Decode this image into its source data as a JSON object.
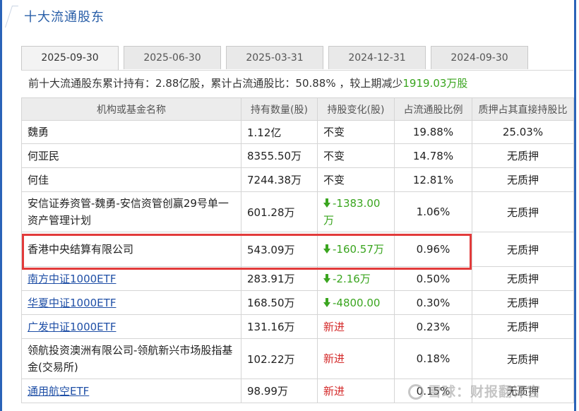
{
  "section_title": "十大流通股东",
  "tabs": [
    {
      "label": "2025-09-30",
      "active": true
    },
    {
      "label": "2025-06-30",
      "active": false
    },
    {
      "label": "2025-03-31",
      "active": false
    },
    {
      "label": "2024-12-31",
      "active": false
    },
    {
      "label": "2024-09-30",
      "active": false
    }
  ],
  "summary": {
    "prefix": "前十大流通股东累计持有：2.88亿股，累计占流通股比：50.88% ，较上期减少",
    "change": "1919.03万股"
  },
  "table": {
    "headers": [
      "机构或基金名称",
      "持有数量(股)",
      "持股变化(股)",
      "占流通股比例",
      "质押占其直接持股比"
    ],
    "rows": [
      {
        "name": "魏勇",
        "link": false,
        "amount": "1.12亿",
        "change": "不变",
        "change_type": "same",
        "pct": "19.88%",
        "pledge": "25.03%"
      },
      {
        "name": "何亚民",
        "link": false,
        "amount": "8355.50万",
        "change": "不变",
        "change_type": "same",
        "pct": "14.78%",
        "pledge": "无质押"
      },
      {
        "name": "何佳",
        "link": false,
        "amount": "7244.38万",
        "change": "不变",
        "change_type": "same",
        "pct": "12.81%",
        "pledge": "无质押"
      },
      {
        "name": "安信证券资管-魏勇-安信资管创赢29号单一资产管理计划",
        "link": false,
        "amount": "601.28万",
        "change": "-1383.00万",
        "change_type": "down",
        "pct": "1.06%",
        "pledge": "无质押"
      },
      {
        "name": "香港中央结算有限公司",
        "link": false,
        "amount": "543.09万",
        "change": "-160.57万",
        "change_type": "down",
        "pct": "0.96%",
        "pledge": "无质押"
      },
      {
        "name": "南方中证1000ETF",
        "link": true,
        "amount": "283.91万",
        "change": "-2.16万",
        "change_type": "down",
        "pct": "0.50%",
        "pledge": "无质押"
      },
      {
        "name": "华夏中证1000ETF",
        "link": true,
        "amount": "168.50万",
        "change": "-4800.00",
        "change_type": "down",
        "pct": "0.30%",
        "pledge": "无质押"
      },
      {
        "name": "广发中证1000ETF",
        "link": true,
        "amount": "131.16万",
        "change": "新进",
        "change_type": "new",
        "pct": "0.23%",
        "pledge": "无质押"
      },
      {
        "name": "领航投资澳洲有限公司-领航新兴市场股指基金(交易所)",
        "link": false,
        "amount": "102.22万",
        "change": "新进",
        "change_type": "new",
        "pct": "0.18%",
        "pledge": "无质押"
      },
      {
        "name": "通用航空ETF",
        "link": true,
        "amount": "98.99万",
        "change": "新进",
        "change_type": "new",
        "pct": "0.15%",
        "pledge": "无质押"
      }
    ]
  },
  "watermark": "雪球：财报翻译官",
  "colors": {
    "accent": "#2a5fa8",
    "green": "#3aa51f",
    "red": "#d42a2a",
    "highlight": "#e23b3b"
  }
}
